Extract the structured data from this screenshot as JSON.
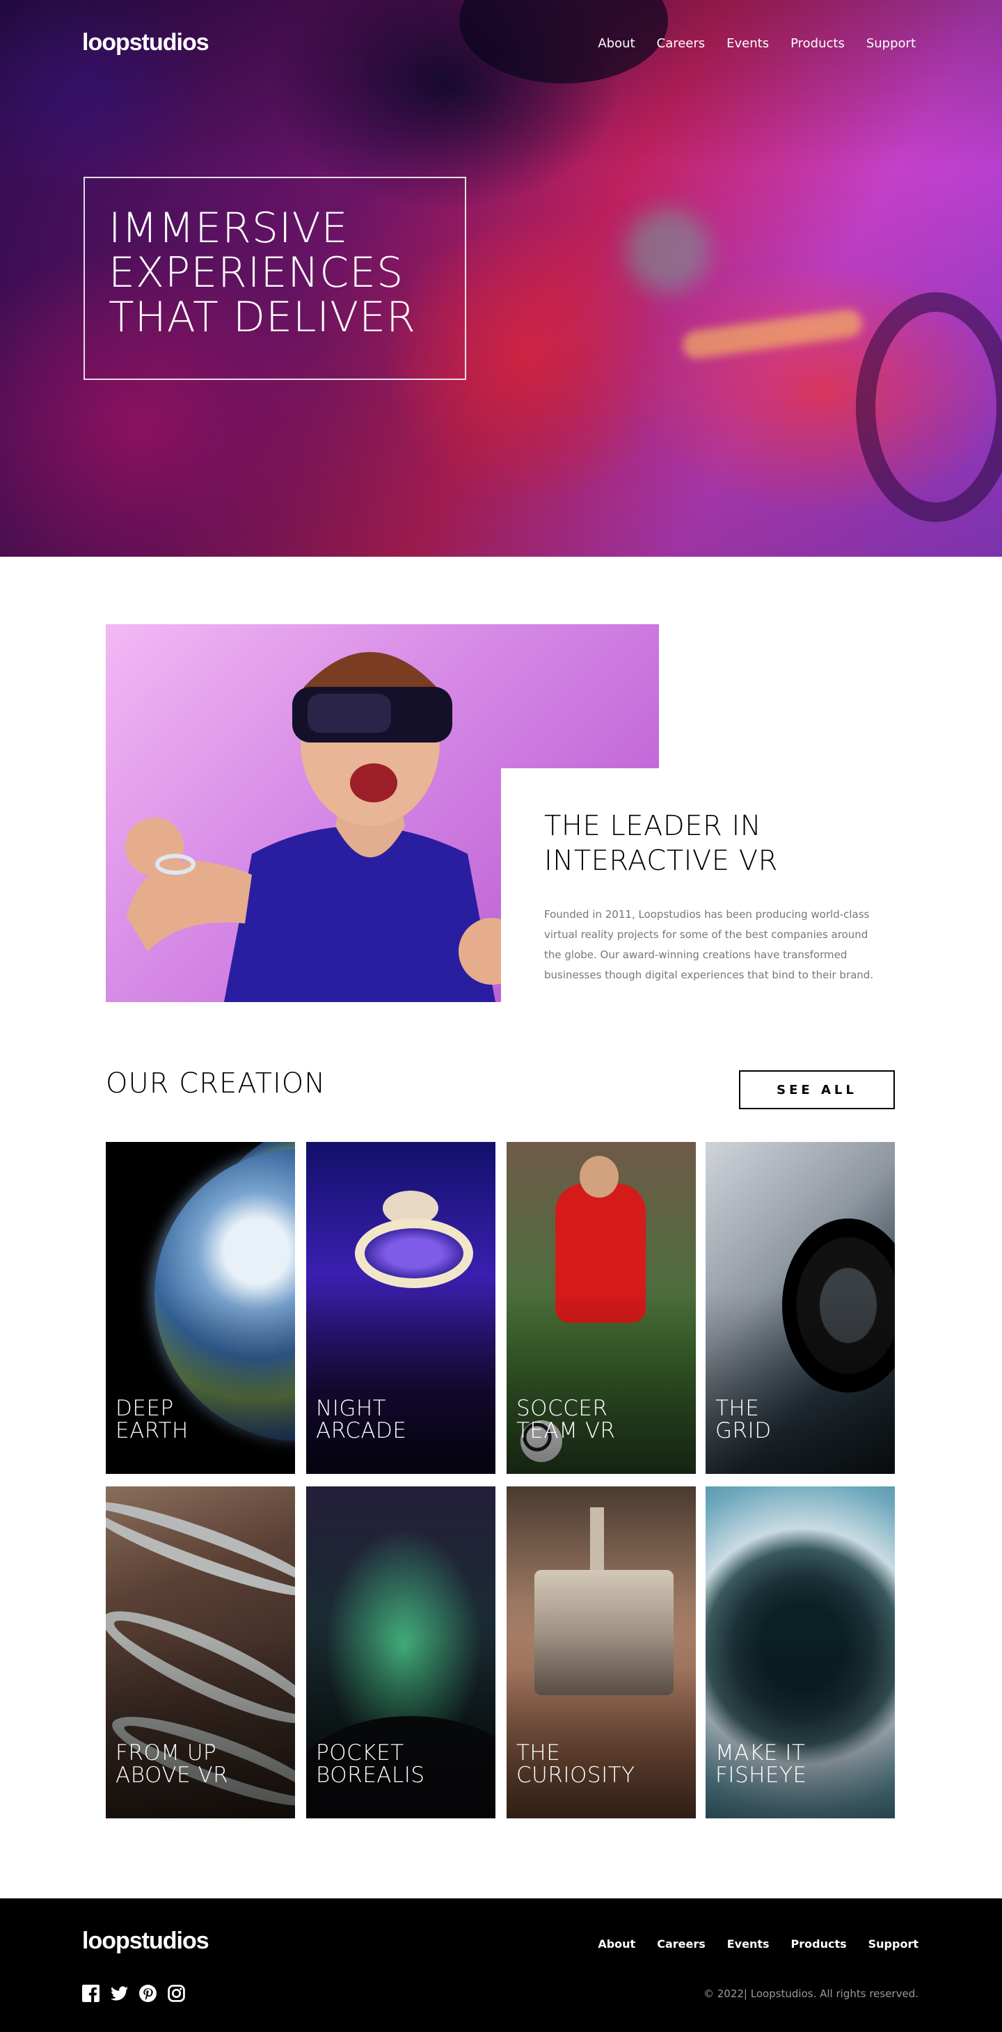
{
  "brand": {
    "logo": "loopstudios"
  },
  "nav": {
    "items": [
      "About",
      "Careers",
      "Events",
      "Products",
      "Support"
    ]
  },
  "hero": {
    "headline_lines": [
      "IMMERSIVE",
      "EXPERIENCES",
      "THAT DELIVER"
    ]
  },
  "intro": {
    "title_lines": [
      "THE LEADER IN",
      "INTERACTIVE VR"
    ],
    "body": "Founded in 2011, Loopstudios has been producing world-class virtual reality projects for some of the best companies around the globe. Our award-winning creations have transformed businesses though digital experiences that bind to their brand."
  },
  "creations": {
    "title": "OUR CREATION",
    "see_all": "SEE ALL",
    "items": [
      {
        "lines": [
          "DEEP",
          "EARTH"
        ]
      },
      {
        "lines": [
          "NIGHT",
          "ARCADE"
        ]
      },
      {
        "lines": [
          "SOCCER",
          "TEAM VR"
        ]
      },
      {
        "lines": [
          "THE",
          "GRID"
        ]
      },
      {
        "lines": [
          "FROM UP",
          "ABOVE VR"
        ]
      },
      {
        "lines": [
          "POCKET",
          "BOREALIS"
        ]
      },
      {
        "lines": [
          "THE",
          "CURIOSITY"
        ]
      },
      {
        "lines": [
          "MAKE IT",
          "FISHEYE"
        ]
      }
    ]
  },
  "footer": {
    "logo": "loopstudios",
    "nav": [
      "About",
      "Careers",
      "Events",
      "Products",
      "Support"
    ],
    "socials": [
      "facebook-icon",
      "twitter-icon",
      "pinterest-icon",
      "instagram-icon"
    ],
    "copyright": "© 2022| Loopstudios. All rights reserved."
  }
}
